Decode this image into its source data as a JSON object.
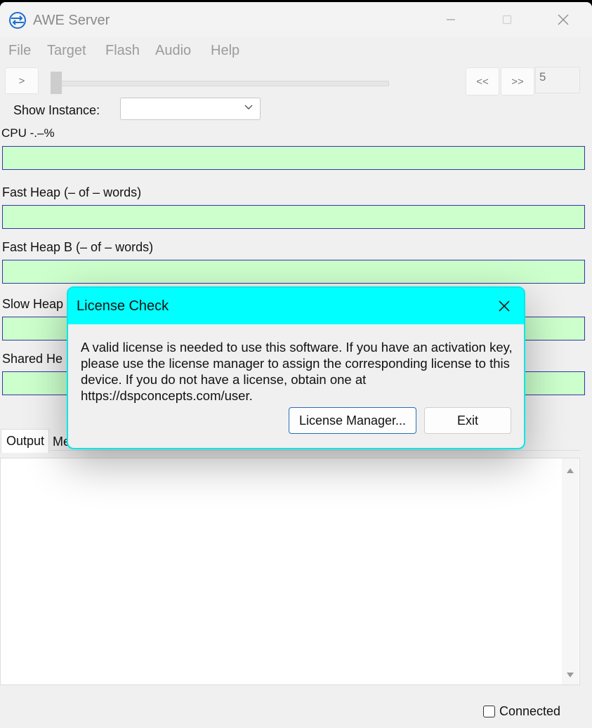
{
  "window": {
    "title": "AWE Server",
    "icons": {
      "app": "awe-logo-icon",
      "minimize": "minimize-icon",
      "maximize": "maximize-icon",
      "close": "close-icon"
    }
  },
  "menu": [
    "File",
    "Target",
    "Flash",
    "Audio",
    "Help"
  ],
  "toolbar": {
    "play_label": ">",
    "prev_label": "<<",
    "next_label": ">>",
    "number_value": "5"
  },
  "instance": {
    "label": "Show Instance:",
    "selected": ""
  },
  "meters": {
    "cpu": "CPU -.–%",
    "fast_heap": "Fast Heap (– of – words)",
    "fast_heap_b": "Fast Heap B (– of – words)",
    "slow_heap": "Slow Heap",
    "shared_heap": "Shared He"
  },
  "colors": {
    "meter_fill": "#ccffcc",
    "meter_border": "#3636a4",
    "dialog_title": "#00ffff"
  },
  "tabs": [
    "Output",
    "Me"
  ],
  "output_text": "",
  "status": {
    "connected_label": "Connected",
    "connected_checked": false
  },
  "dialog": {
    "title": "License Check",
    "message": "A valid license is needed to use this software. If you have an activation key, please use the license manager to assign the corresponding license to this device. If you do not have a license, obtain one at https://dspconcepts.com/user.",
    "license_manager_label": "License Manager...",
    "exit_label": "Exit"
  }
}
